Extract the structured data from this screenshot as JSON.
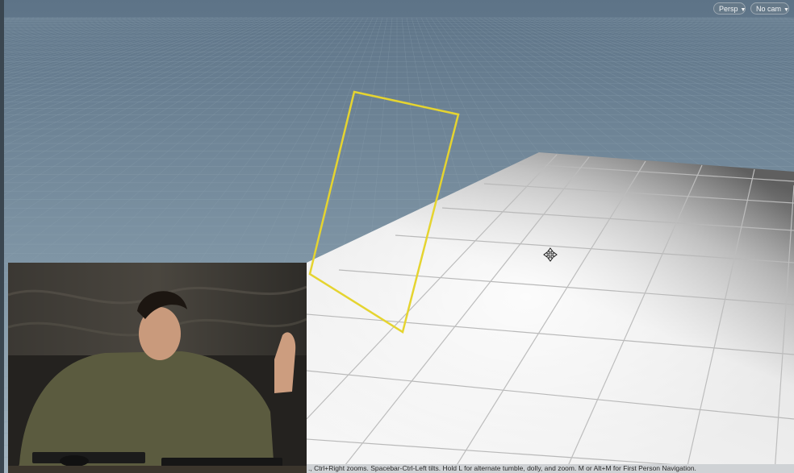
{
  "viewport": {
    "camera_menu": {
      "label": "Persp",
      "icon": "caret-down-icon"
    },
    "camera_source_menu": {
      "label": "No cam",
      "icon": "caret-down-icon"
    },
    "status_hint": "., Ctrl+Right zooms. Spacebar-Ctrl-Left tilts. Hold L for alternate tumble, dolly, and zoom.     M or Alt+M for First Person Navigation."
  },
  "colors": {
    "sky_top": "#60778a",
    "sky_horizon": "#9db0bd",
    "grid_line": "#8aa0ad",
    "floor_light": "#f4f4f4",
    "floor_dark": "#6b6b6b",
    "selection_outline": "#e5d430"
  },
  "icons": {
    "cursor": "move-cursor-icon"
  },
  "webcam_overlay": {
    "description_icon": "presenter-webcam-icon"
  }
}
